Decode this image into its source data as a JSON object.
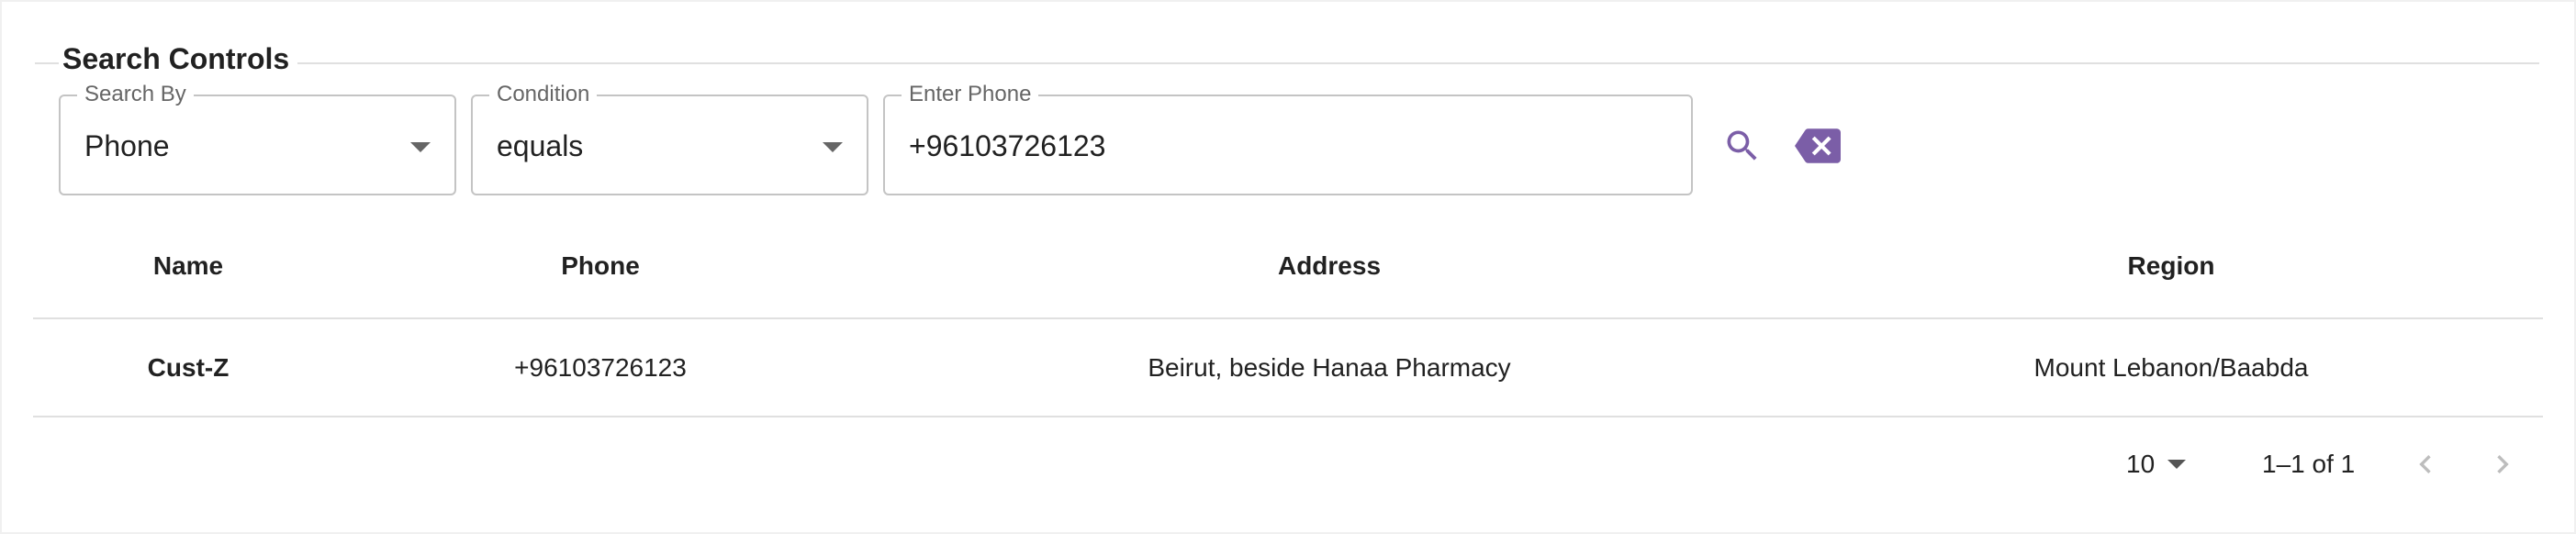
{
  "search_controls": {
    "title": "Search Controls",
    "search_by": {
      "label": "Search By",
      "value": "Phone"
    },
    "condition": {
      "label": "Condition",
      "value": "equals"
    },
    "query": {
      "label": "Enter Phone",
      "value": "+96103726123"
    },
    "search_icon": "search-icon",
    "clear_icon": "backspace-clear-icon",
    "accent_color": "#7b5ea7"
  },
  "table": {
    "columns": [
      "Name",
      "Phone",
      "Address",
      "Region"
    ],
    "rows": [
      [
        "Cust-Z",
        "+96103726123",
        "Beirut, beside Hanaa Pharmacy",
        "Mount Lebanon/Baabda"
      ]
    ]
  },
  "pagination": {
    "rows_per_page": "10",
    "range": "1–1 of 1",
    "prev_icon": "chevron-left-icon",
    "next_icon": "chevron-right-icon"
  }
}
